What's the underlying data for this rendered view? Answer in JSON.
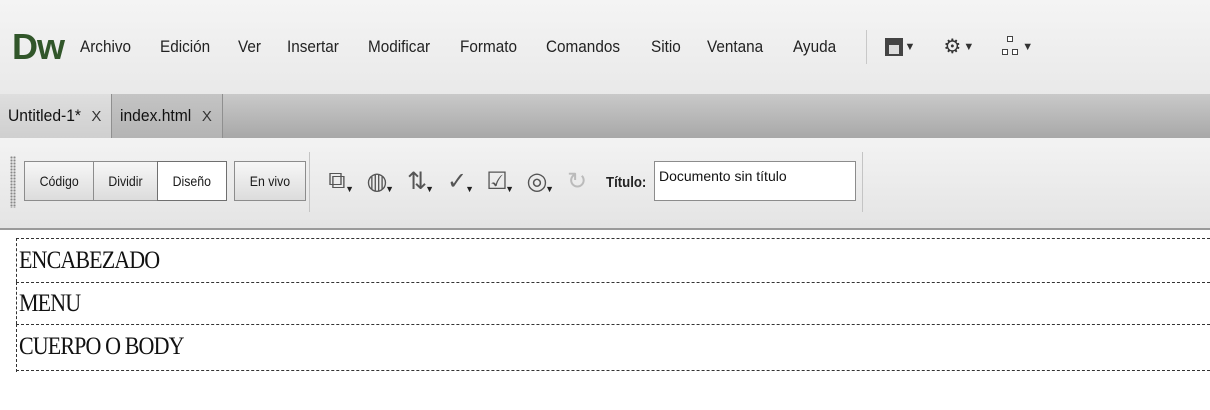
{
  "app": {
    "logo": "Dw"
  },
  "menu": {
    "items": [
      "Archivo",
      "Edición",
      "Ver",
      "Insertar",
      "Modificar",
      "Formato",
      "Comandos",
      "Sitio",
      "Ventana",
      "Ayuda"
    ],
    "icons": [
      "layout-icon",
      "gear-icon",
      "sitemap-icon"
    ]
  },
  "tabs": [
    {
      "label": "Untitled-1*",
      "close": "X",
      "active": true
    },
    {
      "label": "index.html",
      "close": "X",
      "active": false
    }
  ],
  "toolbar": {
    "views": [
      "Código",
      "Dividir",
      "Diseño",
      "En vivo"
    ],
    "active_view": "Diseño",
    "title_label": "Título:",
    "title_value": "Documento sin título"
  },
  "document": {
    "blocks": [
      "ENCABEZADO",
      "MENU",
      "CUERPO O BODY"
    ]
  },
  "colors": {
    "logo": "#31562a",
    "tabbar": "#b4b4b4",
    "toolbar": "#ececec"
  }
}
